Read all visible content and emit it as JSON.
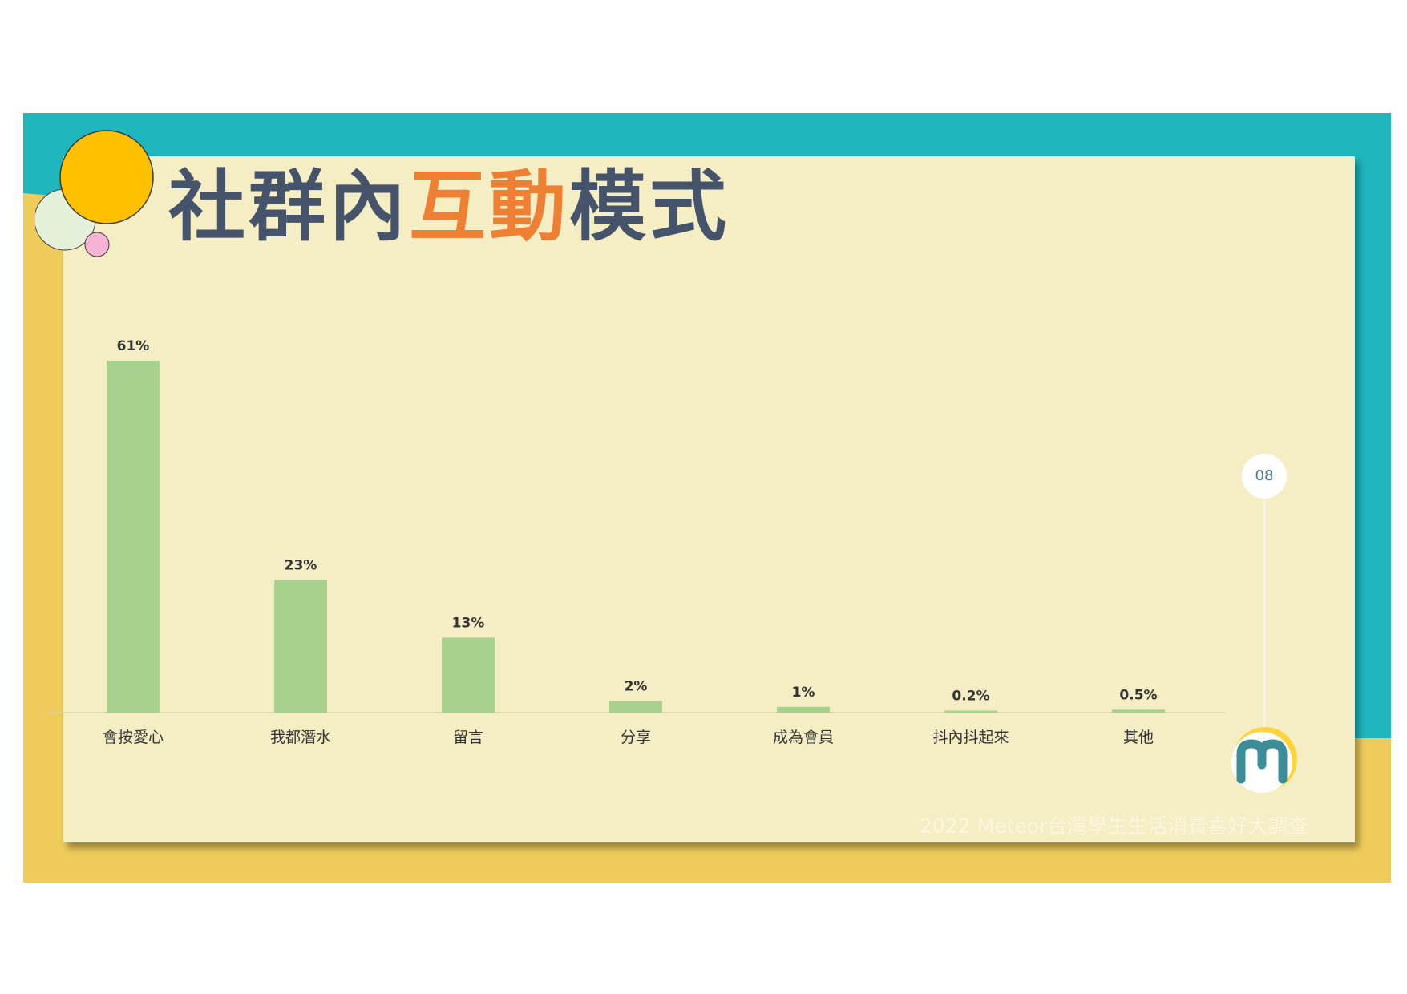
{
  "title": {
    "part1": "社群內",
    "highlight": "互動",
    "part2": "模式"
  },
  "page_number": "08",
  "footer": "2022 Meteor台灣學生生活消費喜好大調查",
  "logo": {
    "icon": "meteor-m-logo"
  },
  "colors": {
    "teal": "#1fb6bd",
    "yellow": "#eecb5a",
    "card": "#f5edc3",
    "bar": "#a8d18d",
    "title": "#45546a",
    "title_highlight": "#ef7f33"
  },
  "chart_data": {
    "type": "bar",
    "categories": [
      "會按愛心",
      "我都潛水",
      "留言",
      "分享",
      "成為會員",
      "抖內抖起來",
      "其他"
    ],
    "values": [
      61,
      23,
      13,
      2,
      1,
      0.2,
      0.5
    ],
    "value_labels": [
      "61%",
      "23%",
      "13%",
      "2%",
      "1%",
      "0.2%",
      "0.5%"
    ],
    "title": "",
    "xlabel": "",
    "ylabel": "",
    "ylim": [
      0,
      65
    ],
    "grid": false,
    "legend": "none"
  }
}
